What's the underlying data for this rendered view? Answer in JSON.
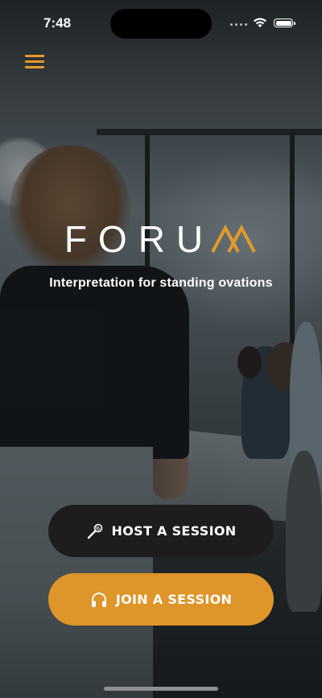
{
  "status_bar": {
    "time": "7:48"
  },
  "brand": {
    "logo_text": "FORU",
    "logo_mark": "M",
    "tagline": "Interpretation for standing ovations",
    "accent_color": "#e39a2a"
  },
  "actions": {
    "host": {
      "label": "HOST A SESSION",
      "icon": "microphone-icon"
    },
    "join": {
      "label": "JOIN A SESSION",
      "icon": "headphones-icon"
    }
  },
  "colors": {
    "host_button": "#1d1d1f",
    "join_button": "#de9529"
  }
}
